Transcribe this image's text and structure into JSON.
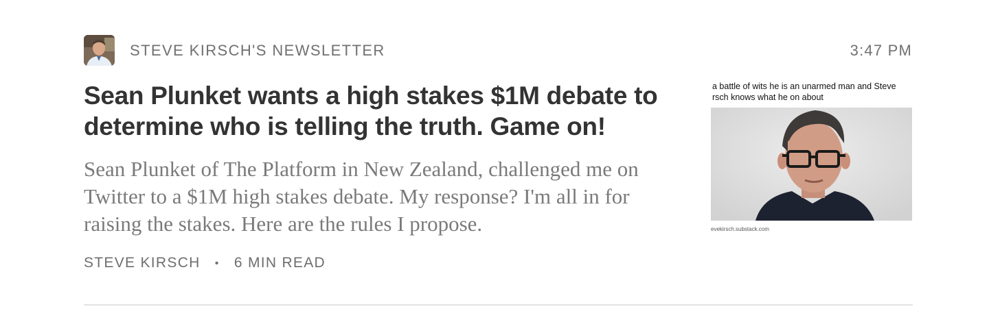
{
  "publication": {
    "name": "STEVE KIRSCH'S NEWSLETTER"
  },
  "timestamp": "3:47 PM",
  "post": {
    "title": "Sean Plunket wants a high stakes $1M debate to determine who is telling the truth. Game on!",
    "subtitle": "Sean Plunket of The Platform in New Zealand, challenged me on Twitter to a $1M high stakes debate. My response? I'm all in for raising the stakes. Here are the rules I propose.",
    "author": "STEVE KIRSCH",
    "separator": "•",
    "read_time": "6 MIN READ"
  },
  "thumbnail": {
    "caption": "a battle of wits he is an unarmed man and Steve\nrsch knows what he on about",
    "source": "evekirsch.substack.com"
  },
  "icons": {
    "avatar": "author-portrait-avatar",
    "thumbnail": "man-with-glasses-photo"
  }
}
